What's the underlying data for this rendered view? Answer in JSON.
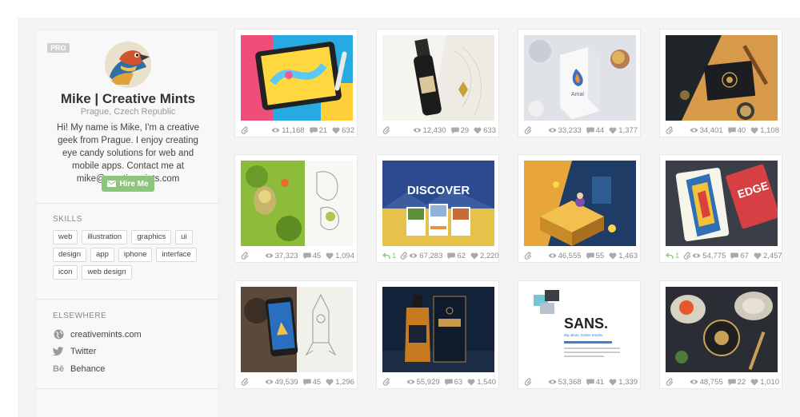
{
  "profile": {
    "badge": "PRO",
    "name": "Mike | Creative Mints",
    "location": "Prague, Czech Republic",
    "bio": "Hi! My name is Mike, I'm a creative geek from Prague. I enjoy creating eye candy solutions for web and mobile apps. Contact me at mike@creativemints.com",
    "hire_label": "Hire Me"
  },
  "skills": {
    "title": "SKILLS",
    "tags": [
      "web",
      "illustration",
      "graphics",
      "ui",
      "design",
      "app",
      "iphone",
      "interface",
      "icon",
      "web design"
    ]
  },
  "elsewhere": {
    "title": "ELSEWHERE",
    "links": [
      {
        "label": "creativemints.com",
        "icon": "globe-icon"
      },
      {
        "label": "Twitter",
        "icon": "twitter-icon"
      },
      {
        "label": "Behance",
        "icon": "behance-icon"
      }
    ]
  },
  "shots": [
    {
      "views": "11,168",
      "comments": "21",
      "likes": "632",
      "rebounds": ""
    },
    {
      "views": "12,430",
      "comments": "29",
      "likes": "633",
      "rebounds": ""
    },
    {
      "views": "33,233",
      "comments": "44",
      "likes": "1,377",
      "rebounds": ""
    },
    {
      "views": "34,401",
      "comments": "40",
      "likes": "1,108",
      "rebounds": ""
    },
    {
      "views": "37,323",
      "comments": "45",
      "likes": "1,094",
      "rebounds": ""
    },
    {
      "views": "67,283",
      "comments": "62",
      "likes": "2,220",
      "rebounds": "1"
    },
    {
      "views": "46,555",
      "comments": "55",
      "likes": "1,463",
      "rebounds": ""
    },
    {
      "views": "54,775",
      "comments": "67",
      "likes": "2,457",
      "rebounds": "1"
    },
    {
      "views": "49,539",
      "comments": "45",
      "likes": "1,296",
      "rebounds": ""
    },
    {
      "views": "55,929",
      "comments": "63",
      "likes": "1,540",
      "rebounds": ""
    },
    {
      "views": "53,368",
      "comments": "41",
      "likes": "1,339",
      "rebounds": ""
    },
    {
      "views": "48,755",
      "comments": "22",
      "likes": "1,010",
      "rebounds": ""
    }
  ],
  "shot_texts": {
    "discover": "DISCOVER",
    "amal": "Amal",
    "sans": "SANS.",
    "sans_sub": "Big ideas, bolder results.",
    "edge": "EDGE"
  },
  "colors": {
    "hire_green": "#8cc67a",
    "rebound_green": "#8cc67a",
    "meta_grey": "#888888"
  }
}
